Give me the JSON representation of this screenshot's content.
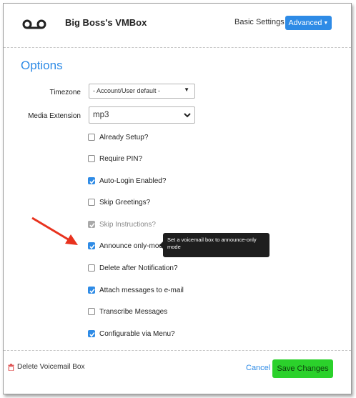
{
  "header": {
    "title": "Big Boss's VMBox",
    "basic_settings_label": "Basic Settings",
    "advanced_label": "Advanced"
  },
  "section": {
    "title": "Options"
  },
  "fields": {
    "timezone": {
      "label": "Timezone",
      "value": "- Account/User default -"
    },
    "media_extension": {
      "label": "Media Extension",
      "value": "mp3"
    }
  },
  "checkboxes": [
    {
      "label": "Already Setup?",
      "checked": false,
      "disabled": false
    },
    {
      "label": "Require PIN?",
      "checked": false,
      "disabled": false
    },
    {
      "label": "Auto-Login Enabled?",
      "checked": true,
      "disabled": false
    },
    {
      "label": "Skip Greetings?",
      "checked": false,
      "disabled": false
    },
    {
      "label": "Skip Instructions?",
      "checked": true,
      "disabled": true
    },
    {
      "label": "Announce only-mode",
      "checked": true,
      "disabled": false
    },
    {
      "label": "Delete after Notification?",
      "checked": false,
      "disabled": false
    },
    {
      "label": "Attach messages to e-mail",
      "checked": true,
      "disabled": false
    },
    {
      "label": "Transcribe Messages",
      "checked": false,
      "disabled": false
    },
    {
      "label": "Configurable via Menu?",
      "checked": true,
      "disabled": false
    }
  ],
  "tooltip": {
    "text": "Set a voicemail box to announce-only mode"
  },
  "footer": {
    "delete_label": "Delete Voicemail Box",
    "cancel_label": "Cancel",
    "save_label": "Save Changes"
  },
  "colors": {
    "accent": "#2e8be6",
    "save": "#2bd12b",
    "annotation_arrow": "#e8321e",
    "delete_icon": "#e05a5a"
  },
  "icons": {
    "voicemail": "voicemail-icon",
    "trash": "trash-icon",
    "check": "check-icon",
    "annotation": "red-arrow"
  }
}
